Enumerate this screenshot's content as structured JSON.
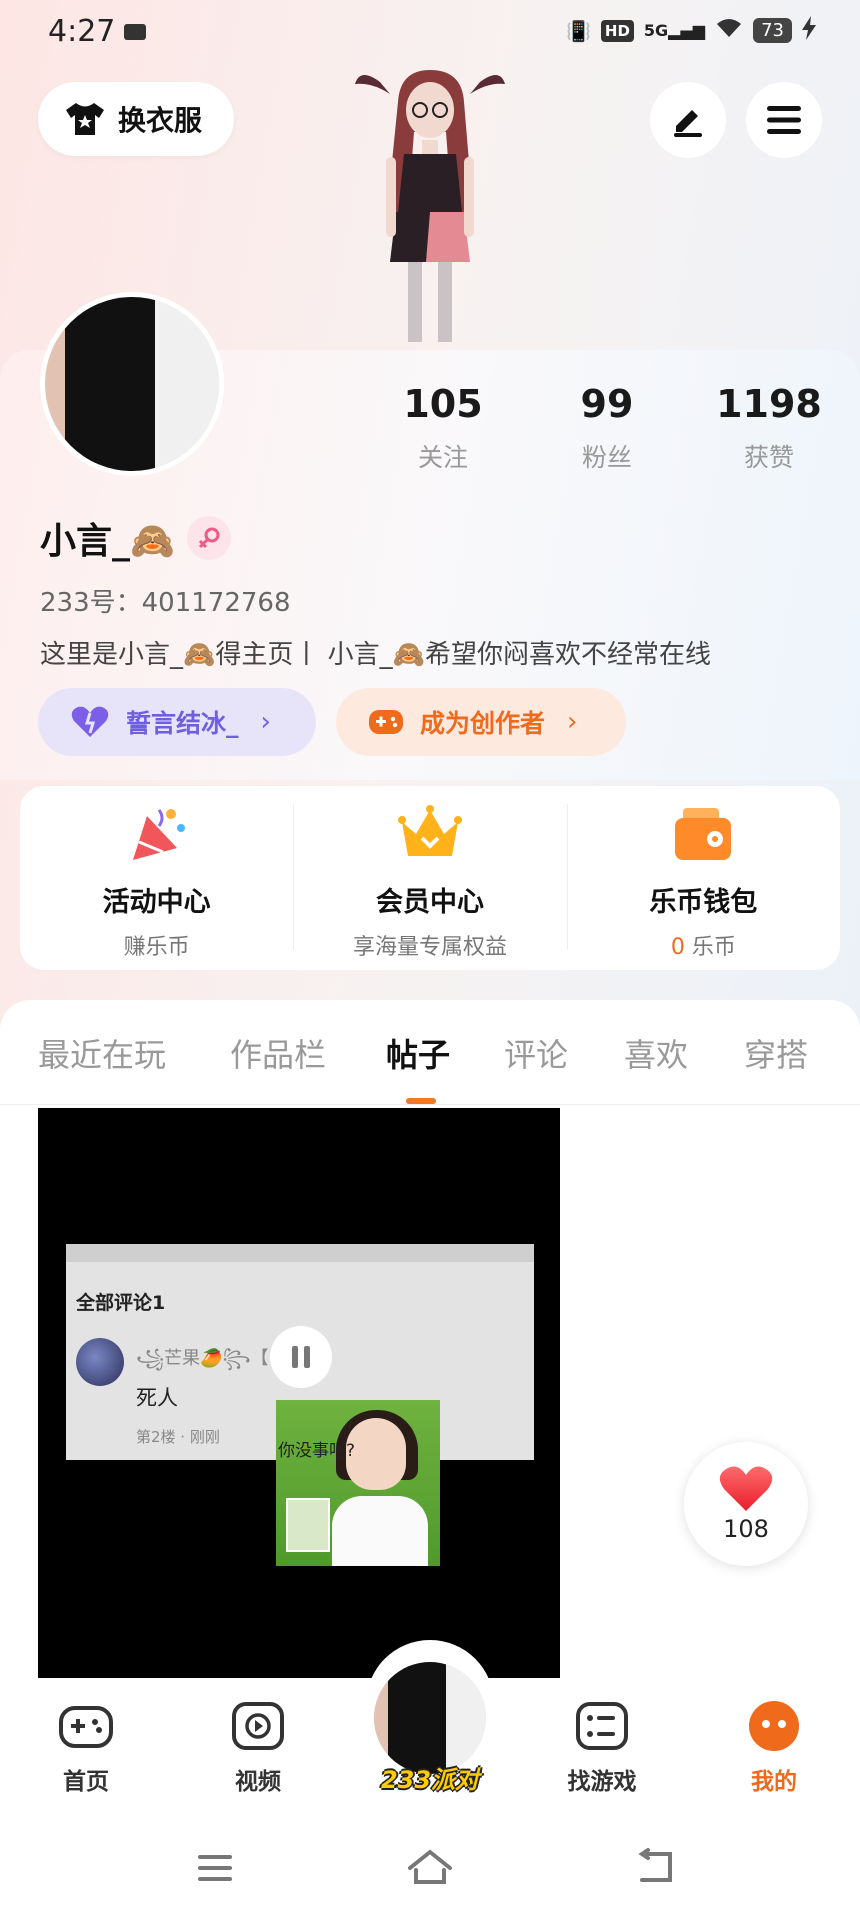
{
  "status_bar": {
    "time": "4:27",
    "network": "5G",
    "hd": "HD",
    "battery": "73"
  },
  "top": {
    "outfit_label": "换衣服"
  },
  "stats": [
    {
      "value": "105",
      "label": "关注"
    },
    {
      "value": "99",
      "label": "粉丝"
    },
    {
      "value": "1198",
      "label": "获赞"
    }
  ],
  "profile": {
    "username": "小言_🙈",
    "id_text": "233号：401172768",
    "bio": "这里是小言_🙈得主页丨 小言_🙈希望你闷喜欢不经常在线"
  },
  "pills": [
    {
      "label": "誓言结冰_"
    },
    {
      "label": "成为创作者"
    }
  ],
  "services": [
    {
      "title": "活动中心",
      "sub": "赚乐币"
    },
    {
      "title": "会员中心",
      "sub": "享海量专属权益"
    },
    {
      "title": "乐币钱包",
      "sub_value": "0",
      "sub_unit": "乐币"
    }
  ],
  "tabs": [
    "最近在玩",
    "作品栏",
    "帖子",
    "评论",
    "喜欢",
    "穿搭"
  ],
  "active_tab": "帖子",
  "post": {
    "comment_title": "全部评论1",
    "comment_user": "꧁芒果🥭꧂【",
    "comment_text": "死人",
    "comment_meta": "第2楼 · 刚刚",
    "meme_text": "你没事吧?",
    "likes": "108"
  },
  "bottom_nav": [
    {
      "label": "首页",
      "icon": "gamepad-icon"
    },
    {
      "label": "视频",
      "icon": "play-icon"
    },
    {
      "label": "233派对",
      "icon": "avatar"
    },
    {
      "label": "找游戏",
      "icon": "list-icon"
    },
    {
      "label": "我的",
      "icon": "profile-dots-icon"
    }
  ],
  "colors": {
    "accent": "#f06a1c",
    "purple": "#6f5fe0",
    "like_red": "#f23a3a"
  }
}
